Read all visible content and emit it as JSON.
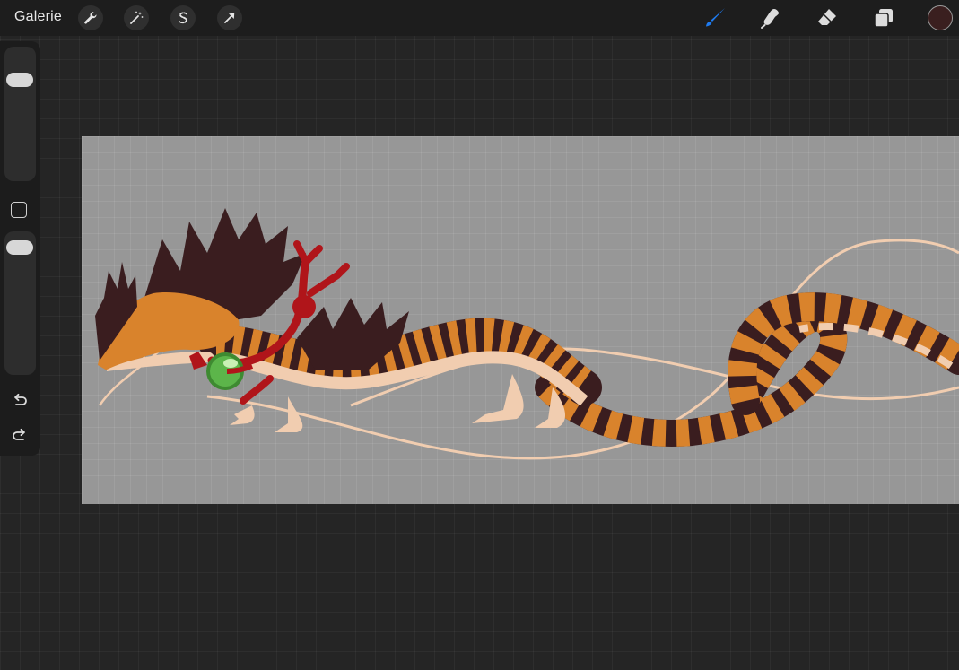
{
  "topbar": {
    "gallery_label": "Galerie",
    "left_tools": [
      {
        "name": "wrench-icon"
      },
      {
        "name": "magic-wand-icon"
      },
      {
        "name": "selection-s-icon"
      },
      {
        "name": "transform-arrow-icon"
      }
    ],
    "right_tools": [
      {
        "name": "brush-icon",
        "active_color": "#1e7bf0"
      },
      {
        "name": "smudge-icon"
      },
      {
        "name": "eraser-icon"
      },
      {
        "name": "layers-icon"
      }
    ],
    "current_color": "#3a1f1f"
  },
  "sidebar": {
    "brush_size_level": 0.17,
    "opacity_level": 0.0,
    "buttons": [
      "modifier-square-icon",
      "undo-icon",
      "redo-icon"
    ]
  },
  "canvas": {
    "background": "#979797",
    "artwork": "dragon-illustration"
  },
  "colors": {
    "dark_brown": "#3a1d1f",
    "orange": "#d9832c",
    "cream": "#f1cdb0",
    "red": "#b0151a",
    "green_orb": "#5cb54a"
  }
}
